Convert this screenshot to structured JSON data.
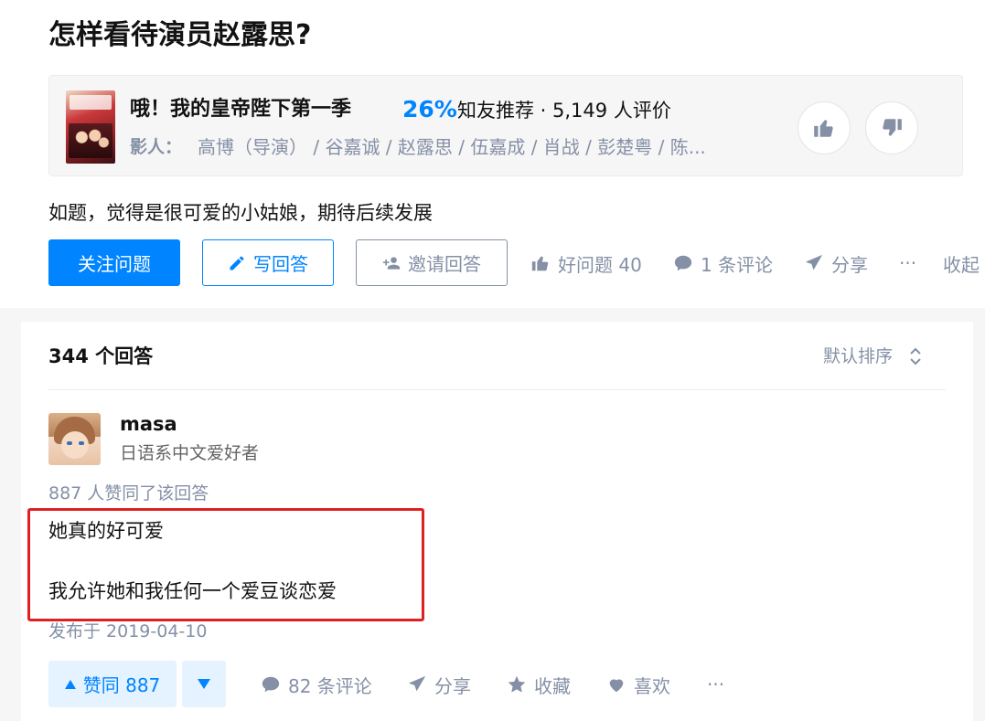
{
  "question": {
    "title": "怎样看待演员赵露思?",
    "detail": "如题，觉得是很可爱的小姑娘，期待后续发展"
  },
  "media": {
    "name": "哦！我的皇帝陛下第一季",
    "score": "26%",
    "meta": "知友推荐 · 5,149 人评价",
    "cast_label": "影人：",
    "cast": "高博（导演） / 谷嘉诚 / 赵露思 / 伍嘉成 / 肖战 / 彭楚粤 / 陈..."
  },
  "actions": {
    "follow": "关注问题",
    "write": "写回答",
    "invite": "邀请回答",
    "good_question": "好问题 40",
    "comments": "1 条评论",
    "share": "分享",
    "more": "···",
    "collapse": "收起"
  },
  "answers": {
    "count": "344 个回答",
    "sort": "默认排序",
    "first": {
      "author": "masa",
      "bio": "日语系中文爱好者",
      "votes_text": "887 人赞同了该回答",
      "line1": "她真的好可爱",
      "line2": "我允许她和我任何一个爱豆谈恋爱",
      "published": "发布于 2019-04-10",
      "upvote": "赞同 887",
      "comments": "82 条评论",
      "share": "分享",
      "collect": "收藏",
      "like": "喜欢",
      "more": "···"
    }
  },
  "colors": {
    "primary": "#0084ff",
    "muted": "#8590a6",
    "highlight": "#e02020"
  }
}
